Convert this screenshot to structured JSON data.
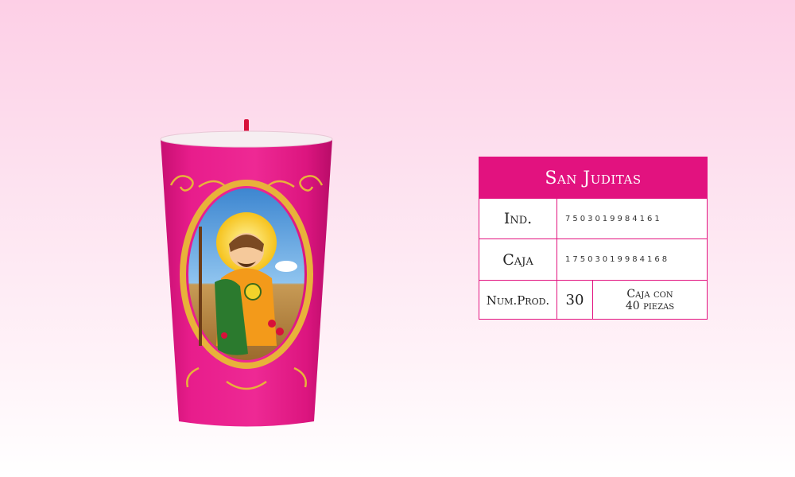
{
  "product": {
    "title": "San Juditas",
    "rows": {
      "ind_label": "Ind.",
      "ind_code": "7503019984161",
      "caja_label": "Caja",
      "caja_code": "17503019984168",
      "numprod_label": "Num.Prod.",
      "numprod_value": "30",
      "box_line1": "Caja con",
      "box_line2": "40 piezas"
    }
  },
  "colors": {
    "brand_pink": "#e2127f",
    "candle_magenta": "#e21a86",
    "ornament_gold": "#e8b23a"
  },
  "image": {
    "subject": "candle-san-judas-tadeo-icon"
  }
}
